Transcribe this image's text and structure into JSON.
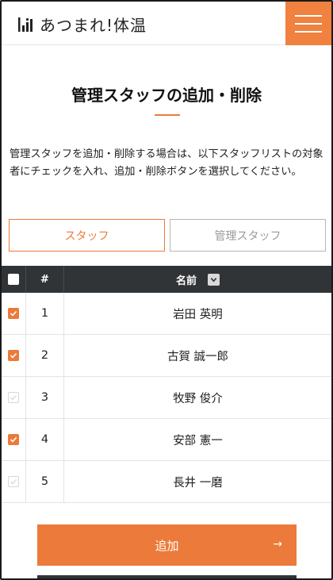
{
  "header": {
    "logo_text": "あつまれ!体温",
    "menu_icon": "hamburger-icon"
  },
  "page": {
    "title": "管理スタッフの追加・削除",
    "description": "管理スタッフを追加・削除する場合は、以下スタッフリストの対象者にチェックを入れ、追加・削除ボタンを選択してください。"
  },
  "tabs": [
    {
      "label": "スタッフ",
      "active": true
    },
    {
      "label": "管理スタッフ",
      "active": false
    }
  ],
  "table": {
    "headers": {
      "num": "#",
      "name": "名前"
    },
    "rows": [
      {
        "num": "1",
        "name": "岩田 英明",
        "checked": true
      },
      {
        "num": "2",
        "name": "古賀 誠一郎",
        "checked": true
      },
      {
        "num": "3",
        "name": "牧野 俊介",
        "checked": false
      },
      {
        "num": "4",
        "name": "安部 憲一",
        "checked": true
      },
      {
        "num": "5",
        "name": "長井 一磨",
        "checked": false
      }
    ]
  },
  "actions": {
    "add_label": "追加",
    "add_arrow": "→"
  },
  "colors": {
    "accent": "#ec7a3a",
    "header_dark": "#313436"
  }
}
